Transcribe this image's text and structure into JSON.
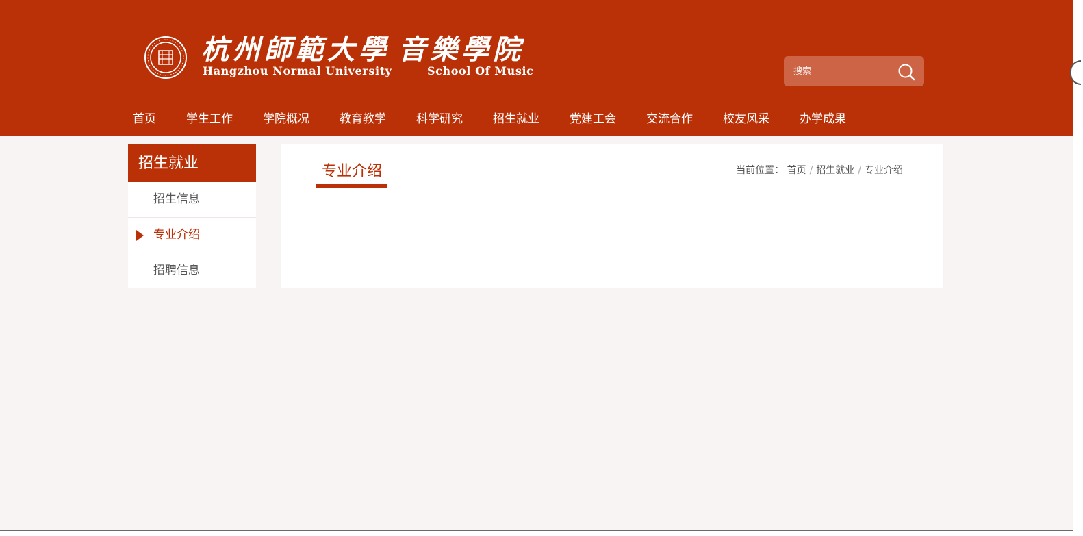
{
  "header": {
    "logo": {
      "calligraphy_university": "杭州師範大學",
      "calligraphy_school": "音樂學院",
      "english_university": "Hangzhou Normal University",
      "english_school": "School Of Music"
    },
    "search": {
      "placeholder": "搜索"
    }
  },
  "nav": {
    "items": [
      "首页",
      "学生工作",
      "学院概况",
      "教育教学",
      "科学研究",
      "招生就业",
      "党建工会",
      "交流合作",
      "校友风采",
      "办学成果"
    ]
  },
  "sidebar": {
    "title": "招生就业",
    "items": [
      {
        "label": "招生信息",
        "active": false
      },
      {
        "label": "专业介绍",
        "active": true
      },
      {
        "label": "招聘信息",
        "active": false
      }
    ]
  },
  "main": {
    "title": "专业介绍",
    "breadcrumb": {
      "prefix": "当前位置：",
      "items": [
        "首页",
        "招生就业",
        "专业介绍"
      ],
      "separator": "/"
    }
  },
  "colors": {
    "brand": "#bb3107",
    "page_bg": "#f8f4f3"
  }
}
